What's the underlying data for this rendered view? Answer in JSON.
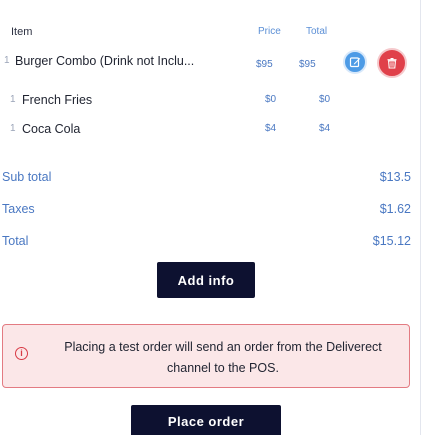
{
  "table": {
    "headers": {
      "item": "Item",
      "price": "Price",
      "total": "Total"
    },
    "rows": [
      {
        "index": "1",
        "name": "Burger Combo (Drink not Inclu...",
        "price": "$95",
        "total": "$95"
      },
      {
        "index": "1",
        "name": "French Fries",
        "price": "$0",
        "total": "$0"
      },
      {
        "index": "1",
        "name": "Coca Cola",
        "price": "$4",
        "total": "$4"
      }
    ]
  },
  "actions": {
    "edit_icon": "edit-icon",
    "delete_icon": "trash-icon"
  },
  "summary": {
    "subtotal_label": "Sub total",
    "subtotal_value": "$13.5",
    "taxes_label": "Taxes",
    "taxes_value": "$1.62",
    "total_label": "Total",
    "total_value": "$15.12"
  },
  "buttons": {
    "add_info": "Add info",
    "place_order": "Place order"
  },
  "alert": {
    "icon": "info-icon",
    "message": "Placing a test order will send an order from the Deliverect channel to the POS."
  },
  "colors": {
    "accent": "#4a78c2",
    "dark": "#0d1130",
    "danger": "#e0404a",
    "edit": "#4d9be6",
    "alert_bg": "#fbe7e8"
  }
}
